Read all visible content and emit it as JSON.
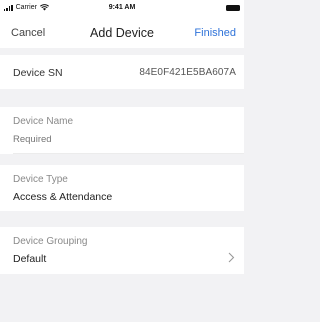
{
  "status_bar": {
    "carrier": "Carrier",
    "time": "9:41 AM"
  },
  "nav": {
    "cancel_label": "Cancel",
    "title": "Add Device",
    "finished_label": "Finished"
  },
  "device_sn": {
    "label": "Device SN",
    "value": "84E0F421E5BA607A"
  },
  "device_name": {
    "label": "Device Name",
    "placeholder": "Required",
    "value": ""
  },
  "device_type": {
    "label": "Device Type",
    "value": "Access & Attendance"
  },
  "device_grouping": {
    "label": "Device Grouping",
    "value": "Default"
  },
  "colors": {
    "accent": "#2f73d9",
    "background": "#f2f2f4"
  }
}
